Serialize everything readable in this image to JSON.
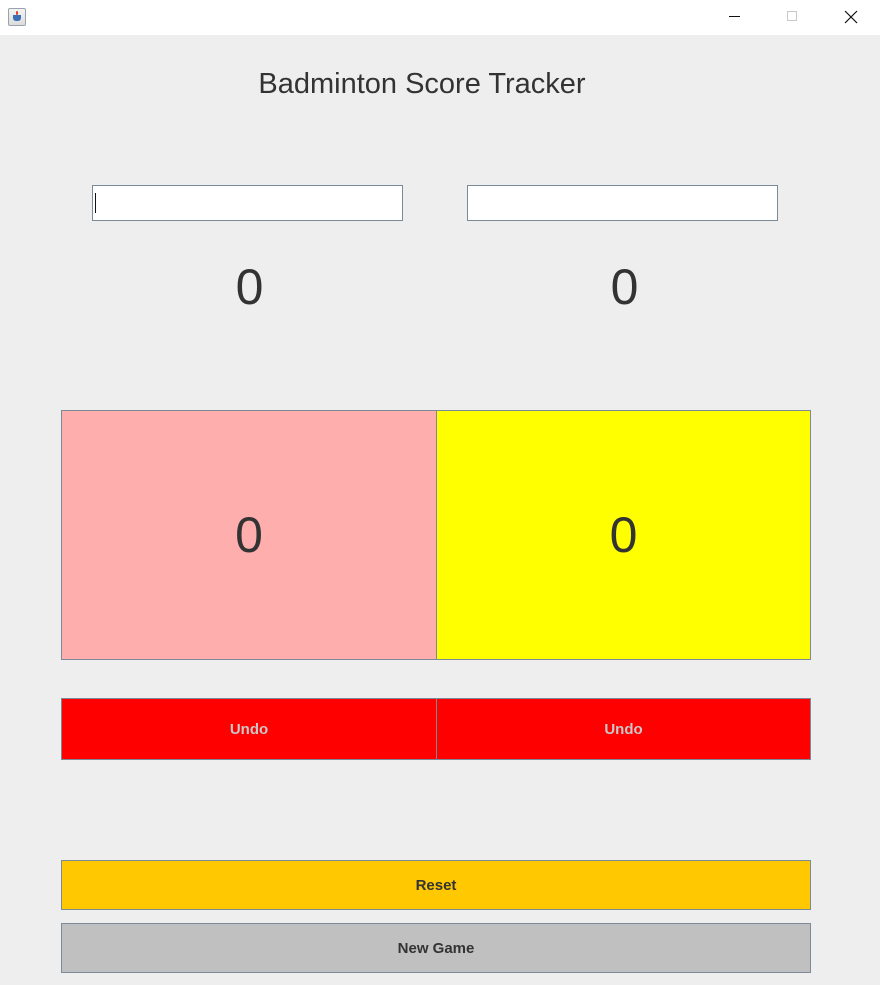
{
  "window": {
    "icon": "java-cup-icon",
    "controls": {
      "minimize": "minimize-icon",
      "maximize": "maximize-icon",
      "close": "close-icon"
    }
  },
  "app": {
    "title": "Badminton Score Tracker"
  },
  "players": [
    {
      "name_value": "",
      "score_label": "0",
      "panel_score": "0",
      "panel_color": "#ffaeae",
      "undo_label": "Undo"
    },
    {
      "name_value": "",
      "score_label": "0",
      "panel_score": "0",
      "panel_color": "#ffff00",
      "undo_label": "Undo"
    }
  ],
  "controls": {
    "reset_label": "Reset",
    "reset_color": "#ffc800",
    "new_game_label": "New Game",
    "new_game_color": "#c0c0c0",
    "undo_color": "#ff0000"
  }
}
